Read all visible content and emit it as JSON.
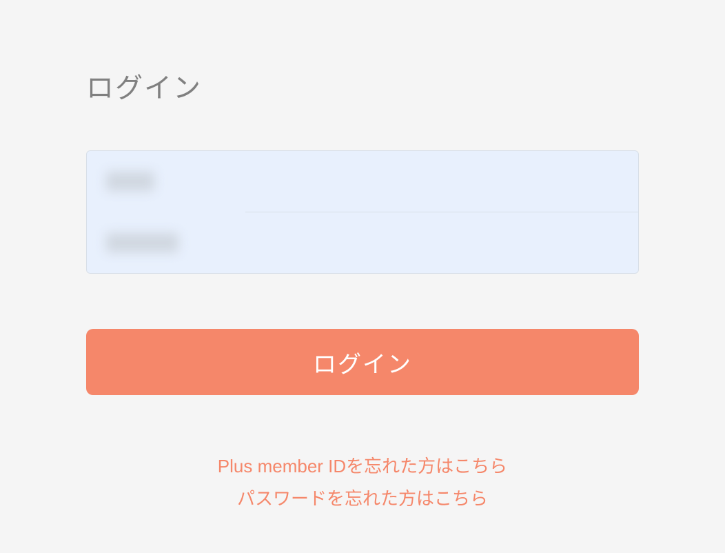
{
  "title": "ログイン",
  "form": {
    "username_value": "",
    "password_value": ""
  },
  "login_button_label": "ログイン",
  "links": {
    "forgot_member_id": "Plus member IDを忘れた方はこちら",
    "forgot_password": "パスワードを忘れた方はこちら"
  },
  "colors": {
    "accent": "#f5876a",
    "background": "#f5f5f5",
    "input_background": "#e8f0fd",
    "title_text": "#808080"
  }
}
